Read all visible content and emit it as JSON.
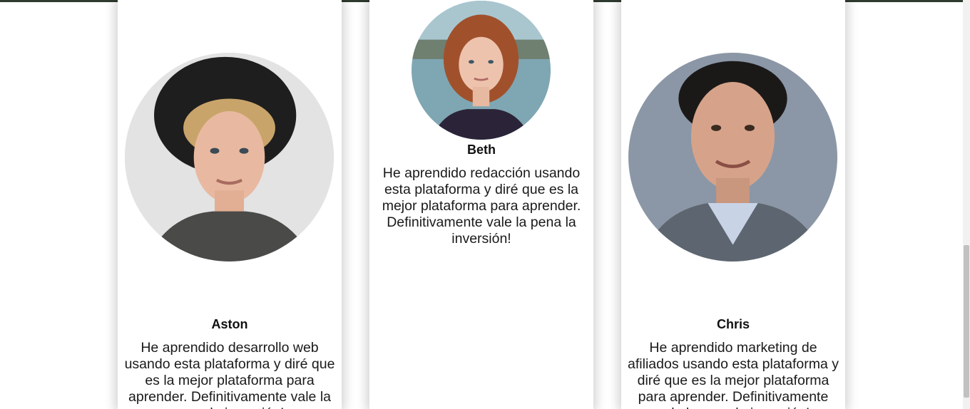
{
  "testimonials": [
    {
      "name": "Aston",
      "quote": "He aprendido desarrollo web usando esta plataforma y diré que es la mejor plataforma para aprender. Definitivamente vale la pena la inversión!",
      "photo_icon": "portrait-man-curly-hair-hat"
    },
    {
      "name": "Beth",
      "quote": "He aprendido redacción usando esta plataforma y diré que es la mejor plataforma para aprender. Definitivamente vale la pena la inversión!",
      "photo_icon": "portrait-woman-red-hair"
    },
    {
      "name": "Chris",
      "quote": "He aprendido marketing de afiliados usando esta plataforma y diré que es la mejor plataforma para aprender. Definitivamente vale la pena la inversión!",
      "photo_icon": "portrait-man-dark-hair-sweater"
    }
  ],
  "colors": {
    "top_rule": "#2e3b2e",
    "card_bg": "#ffffff",
    "text": "#1a1a1a"
  }
}
